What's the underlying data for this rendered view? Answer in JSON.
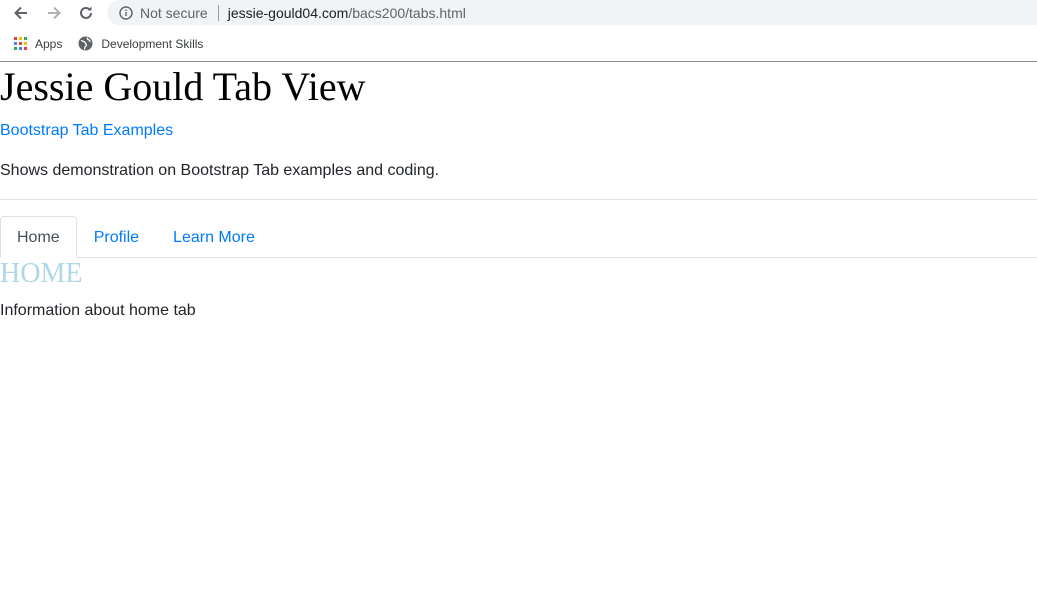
{
  "browser": {
    "security_label": "Not secure",
    "url_host": "jessie-gould04.com",
    "url_path": "/bacs200/tabs.html",
    "bookmarks": [
      {
        "label": "Apps",
        "icon": "apps-grid-icon"
      },
      {
        "label": "Development Skills",
        "icon": "globe-icon"
      }
    ]
  },
  "page": {
    "title": "Jessie Gould Tab View",
    "link_text": "Bootstrap Tab Examples",
    "description": "Shows demonstration on Bootstrap Tab examples and coding."
  },
  "tabs": [
    {
      "label": "Home",
      "active": true
    },
    {
      "label": "Profile",
      "active": false
    },
    {
      "label": "Learn More",
      "active": false
    }
  ],
  "tab_content": {
    "heading": "HOME",
    "text": "Information about home tab"
  },
  "colors": {
    "link": "#007bff",
    "heading_accent": "#add8e6",
    "active_tab_text": "#495057"
  }
}
